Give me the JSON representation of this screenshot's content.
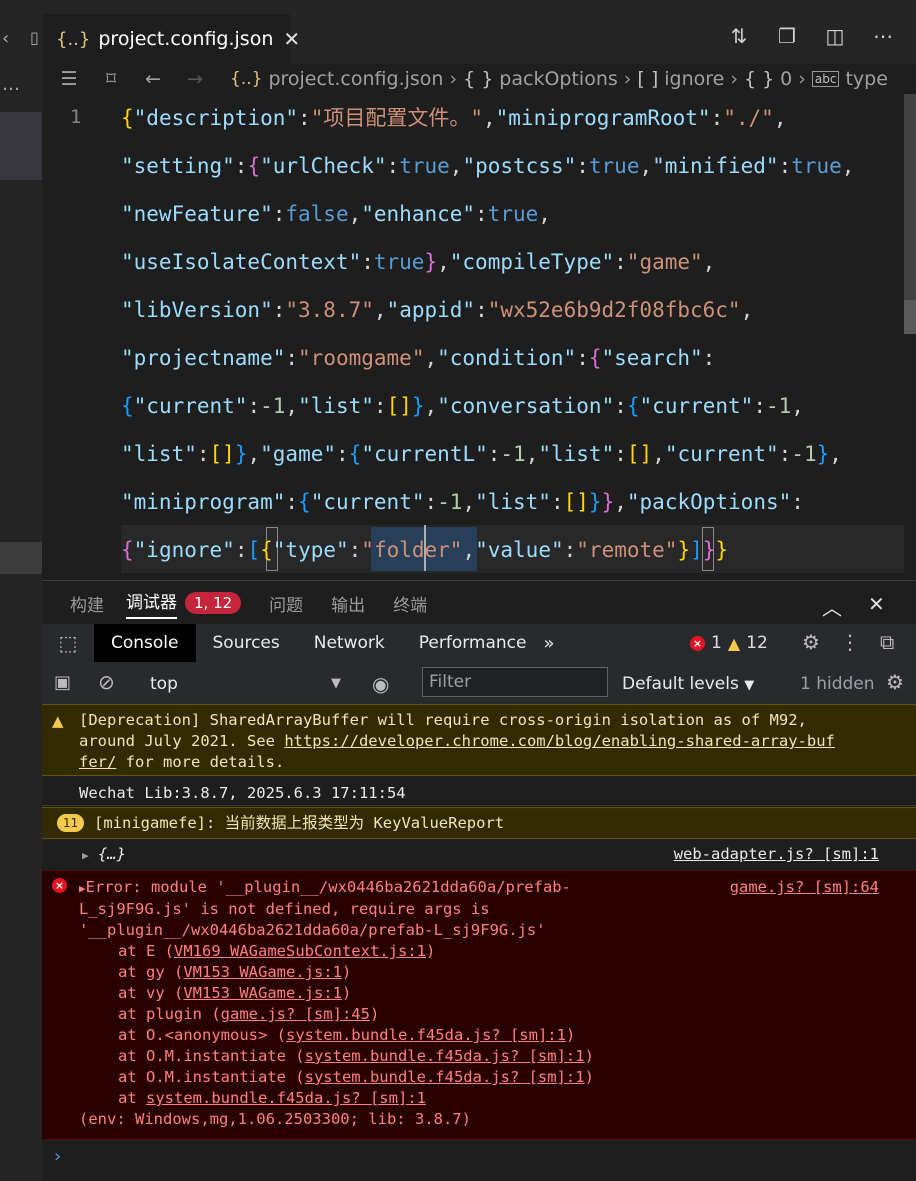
{
  "tab": {
    "filename": "project.config.json",
    "close_glyph": "✕"
  },
  "breadcrumb": {
    "file": "project.config.json",
    "items": [
      "packOptions",
      "ignore",
      "0",
      "type"
    ],
    "item_symbols": [
      "{ }",
      "[ ]",
      "{ }",
      "abc"
    ]
  },
  "editor": {
    "line_number": "1",
    "code_lines": [
      "{\"description\":\"项目配置文件。\",\"miniprogramRoot\":\"./\",",
      "\"setting\":{\"urlCheck\":true,\"postcss\":true,\"minified\":true,",
      "\"newFeature\":false,\"enhance\":true,",
      "\"useIsolateContext\":true},\"compileType\":\"game\",",
      "\"libVersion\":\"3.8.7\",\"appid\":\"wx52e6b9d2f08fbc6c\",",
      "\"projectname\":\"roomgame\",\"condition\":{\"search\":",
      "{\"current\":-1,\"list\":[]},\"conversation\":{\"current\":-1,",
      "\"list\":[]},\"game\":{\"currentL\":-1,\"list\":[],\"current\":-1},",
      "\"miniprogram\":{\"current\":-1,\"list\":[]}},\"packOptions\":",
      "{\"ignore\":[{\"type\":\"folder\",\"value\":\"remote\"}]}}"
    ]
  },
  "panel": {
    "tabs": [
      "构建",
      "调试器",
      "问题",
      "输出",
      "终端"
    ],
    "active_tab": "调试器",
    "badge": "1, 12"
  },
  "devtools": {
    "tabs": [
      "Console",
      "Sources",
      "Network",
      "Performance"
    ],
    "active_tab": "Console",
    "error_count": "1",
    "warning_count": "12",
    "context": "top",
    "filter_placeholder": "Filter",
    "levels": "Default levels",
    "hidden": "1 hidden"
  },
  "console": {
    "deprecation_line1": "[Deprecation] SharedArrayBuffer will require cross-origin isolation as of M92,",
    "deprecation_line2": "around July 2021. See ",
    "deprecation_link_a": "https://developer.chrome.com/blog/enabling-shared-array-buf",
    "deprecation_link_b": "fer/",
    "deprecation_tail": " for more details.",
    "lib_log": "Wechat Lib:3.8.7, 2025.6.3 17:11:54",
    "report_count": "11",
    "report_msg": "[minigamefe]: 当前数据上报类型为 KeyValueReport",
    "object_preview": "{…}",
    "object_source": "web-adapter.js? [sm]:1",
    "error_source": "game.js? [sm]:64",
    "error_lines": [
      "Error: module '__plugin__/wx0446ba2621dda60a/prefab-",
      "L_sj9F9G.js' is not defined, require args is",
      "'__plugin__/wx0446ba2621dda60a/prefab-L_sj9F9G.js'"
    ],
    "stack": [
      {
        "prefix": "at E (",
        "link": "VM169 WAGameSubContext.js:1",
        "suffix": ")"
      },
      {
        "prefix": "at gy (",
        "link": "VM153 WAGame.js:1",
        "suffix": ")"
      },
      {
        "prefix": "at vy (",
        "link": "VM153 WAGame.js:1",
        "suffix": ")"
      },
      {
        "prefix": "at plugin (",
        "link": "game.js? [sm]:45",
        "suffix": ")"
      },
      {
        "prefix": "at O.<anonymous> (",
        "link": "system.bundle.f45da.js? [sm]:1",
        "suffix": ")"
      },
      {
        "prefix": "at O.M.instantiate (",
        "link": "system.bundle.f45da.js? [sm]:1",
        "suffix": ")"
      },
      {
        "prefix": "at O.M.instantiate (",
        "link": "system.bundle.f45da.js? [sm]:1",
        "suffix": ")"
      },
      {
        "prefix": "at ",
        "link": "system.bundle.f45da.js? [sm]:1",
        "suffix": ""
      }
    ],
    "env": "(env: Windows,mg,1.06.2503300; lib: 3.8.7)",
    "prompt": "›"
  },
  "colors": {
    "accent_error": "#e81123",
    "warning": "#f2c94c",
    "badge": "#c5253a"
  }
}
